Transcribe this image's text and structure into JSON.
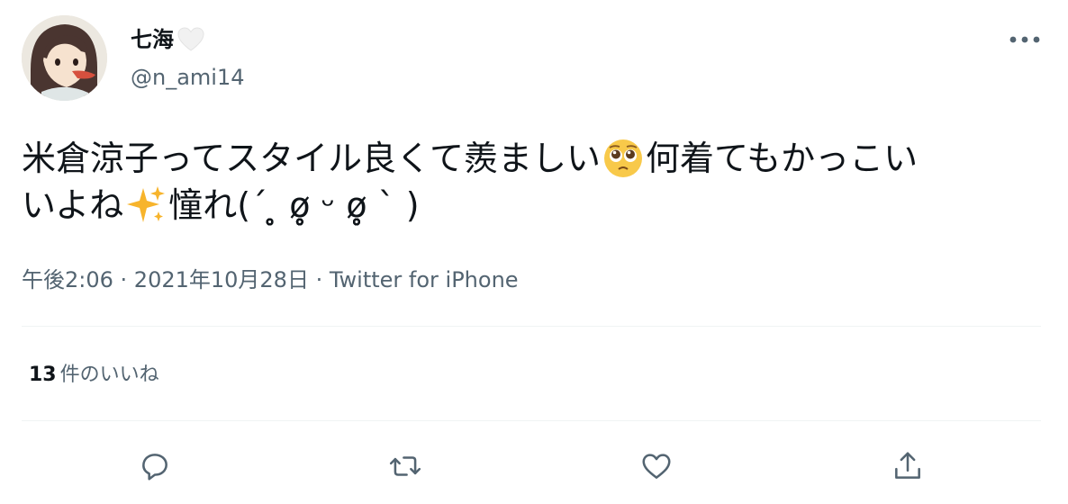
{
  "user": {
    "display_name": "七海",
    "verified_emoji": "white-heart",
    "handle": "@n_ami14"
  },
  "tweet": {
    "line1_a": "米倉涼子ってスタイル良くて羨ましい",
    "line1_emoji": "pleading-face",
    "line1_b": "何着てもかっこい",
    "line2_a": "いよね",
    "line2_emoji": "sparkles",
    "line2_b": "憧れ(´ ̥̥̥̥̥̥̥̥ ø̥̥̥̥̥̥̥̥ ᵕ ø̥̥̥̥̥̥̥̥ ` )"
  },
  "meta": {
    "time": "午後2:06",
    "separator1": " · ",
    "date": "2021年10月28日",
    "separator2": " · ",
    "source": "Twitter for iPhone"
  },
  "stats": {
    "likes_count": "13",
    "likes_label": "件のいいね"
  },
  "actions": [
    "reply-icon",
    "retweet-icon",
    "like-icon",
    "share-icon"
  ],
  "colors": {
    "text": "#0f1419",
    "secondary": "#536471",
    "divider": "#eff3f4"
  }
}
